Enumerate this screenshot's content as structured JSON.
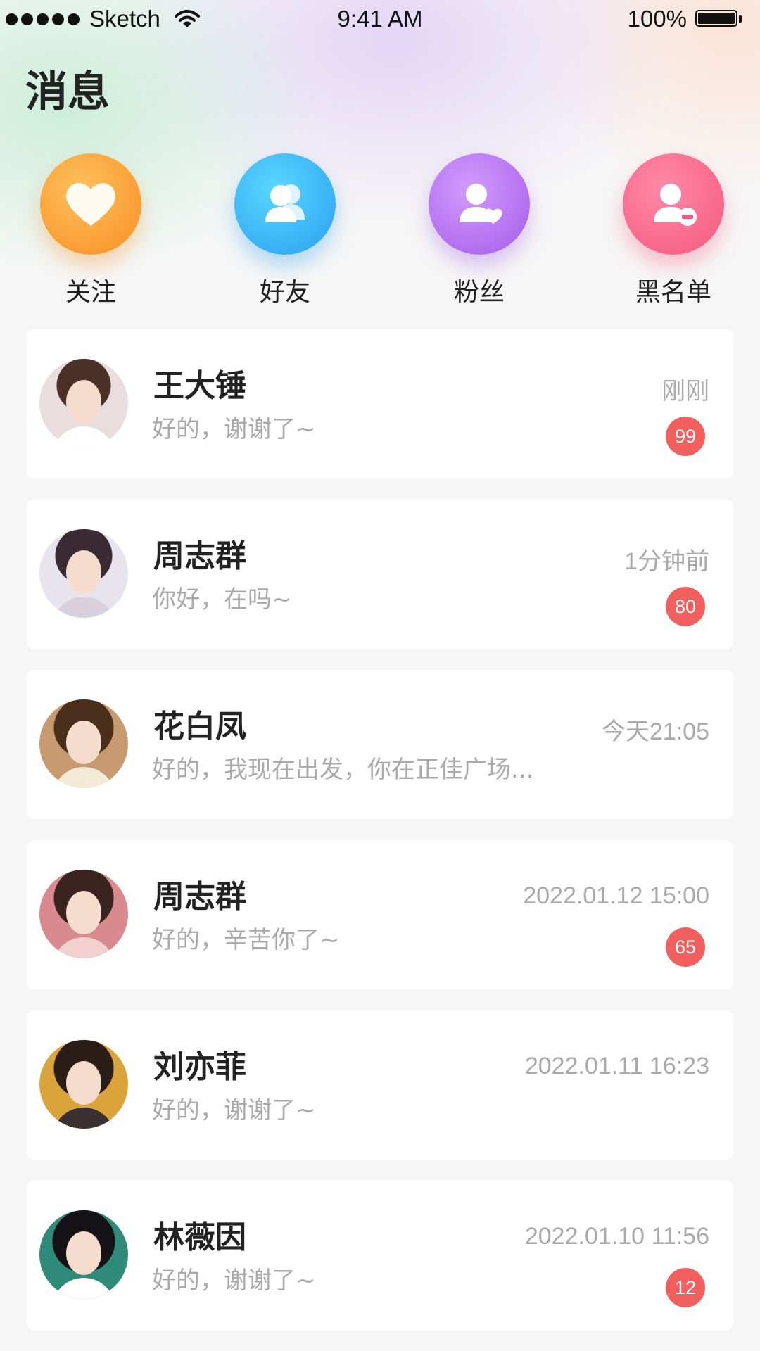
{
  "status_bar": {
    "carrier": "Sketch",
    "time": "9:41 AM",
    "battery": "100%",
    "icons": [
      "signal-dots-icon",
      "wifi-icon",
      "battery-icon"
    ]
  },
  "page": {
    "title": "消息"
  },
  "quick_actions": [
    {
      "label": "关注",
      "icon": "heart-icon",
      "color": "#f98e24"
    },
    {
      "label": "好友",
      "icon": "friends-icon",
      "color": "#2a9ff0"
    },
    {
      "label": "粉丝",
      "icon": "fans-icon",
      "color": "#a35ce8"
    },
    {
      "label": "黑名单",
      "icon": "blacklist-icon",
      "color": "#f5577d"
    }
  ],
  "messages": [
    {
      "name": "王大锤",
      "preview": "好的，谢谢了~",
      "time": "刚刚",
      "badge": "99"
    },
    {
      "name": "周志群",
      "preview": "你好，在吗~",
      "time": "1分钟前",
      "badge": "80"
    },
    {
      "name": "花白凤",
      "preview": "好的，我现在出发，你在正佳广场...",
      "time": "今天21:05",
      "badge": ""
    },
    {
      "name": "周志群",
      "preview": "好的，辛苦你了~",
      "time": "2022.01.12 15:00",
      "badge": "65"
    },
    {
      "name": "刘亦菲",
      "preview": "好的，谢谢了~",
      "time": "2022.01.11 16:23",
      "badge": ""
    },
    {
      "name": "林薇因",
      "preview": "好的，谢谢了~",
      "time": "2022.01.10 11:56",
      "badge": "12"
    }
  ],
  "colors": {
    "badge": "#f15f5f",
    "muted_text": "#aaaaaa",
    "title_text": "#222222"
  }
}
